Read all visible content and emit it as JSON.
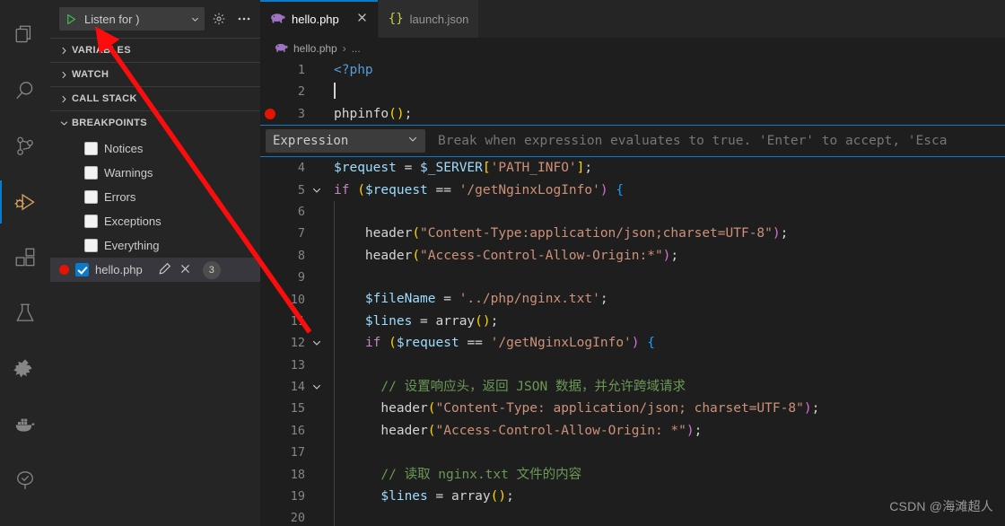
{
  "activity_bar": {
    "items": [
      {
        "name": "explorer",
        "icon": "files-icon",
        "active": false
      },
      {
        "name": "search",
        "icon": "search-icon",
        "active": false
      },
      {
        "name": "source-control",
        "icon": "source-control-icon",
        "active": false
      },
      {
        "name": "run-and-debug",
        "icon": "run-debug-icon",
        "active": true
      },
      {
        "name": "extensions",
        "icon": "extensions-icon",
        "active": false
      },
      {
        "name": "testing",
        "icon": "beaker-icon",
        "active": false
      },
      {
        "name": "php-tools",
        "icon": "php-tools-icon",
        "active": false
      },
      {
        "name": "docker",
        "icon": "docker-whale-icon",
        "active": false
      },
      {
        "name": "source-tree",
        "icon": "tree-check-icon",
        "active": false
      }
    ]
  },
  "sidebar": {
    "toolbar": {
      "start_debug_icon": "play-icon",
      "launch_config": "Listen for )",
      "dropdown_icon": "chevron-down-icon",
      "settings_icon": "gear-icon",
      "more_icon": "ellipsis-icon"
    },
    "sections": [
      {
        "label": "VARIABLES",
        "expanded": false
      },
      {
        "label": "WATCH",
        "expanded": false
      },
      {
        "label": "CALL STACK",
        "expanded": false
      },
      {
        "label": "BREAKPOINTS",
        "expanded": true
      }
    ],
    "breakpoints": [
      {
        "label": "Notices",
        "checked": false
      },
      {
        "label": "Warnings",
        "checked": false
      },
      {
        "label": "Errors",
        "checked": false
      },
      {
        "label": "Exceptions",
        "checked": false
      },
      {
        "label": "Everything",
        "checked": false
      }
    ],
    "selected_breakpoint": {
      "label": "hello.php",
      "checked": true,
      "has_red_dot": true,
      "edit_icon": "pencil-icon",
      "remove_icon": "close-icon",
      "line_badge": "3"
    }
  },
  "editor": {
    "tabs": [
      {
        "label": "hello.php",
        "icon": "php-elephant-icon",
        "active": true,
        "close_icon": "close-icon"
      },
      {
        "label": "launch.json",
        "icon": "json-braces-icon",
        "active": false
      }
    ],
    "breadcrumb": {
      "icon": "php-elephant-icon",
      "file": "hello.php",
      "separator": "›",
      "tail": "..."
    },
    "breakpoint_widget": {
      "condition_type": "Expression",
      "dropdown_icon": "chevron-down-icon",
      "placeholder": "Break when expression evaluates to true. 'Enter' to accept, 'Esca"
    },
    "lines": [
      {
        "num": "1",
        "fold": "",
        "bp": false,
        "indents": 0,
        "tokens": [
          {
            "t": "tag",
            "v": "<?php"
          }
        ]
      },
      {
        "num": "2",
        "fold": "",
        "bp": false,
        "indents": 0,
        "tokens": [
          {
            "t": "cursor",
            "v": ""
          }
        ]
      },
      {
        "num": "3",
        "fold": "",
        "bp": true,
        "indents": 0,
        "tokens": [
          {
            "t": "plain",
            "v": "phpinfo"
          },
          {
            "t": "paren",
            "v": "()"
          },
          {
            "t": "punc",
            "v": ";"
          }
        ]
      },
      {
        "num": "4",
        "fold": "",
        "bp": false,
        "indents": 0,
        "tokens": [
          {
            "t": "var",
            "v": "$request"
          },
          {
            "t": "op",
            "v": " = "
          },
          {
            "t": "var",
            "v": "$_SERVER"
          },
          {
            "t": "brk",
            "v": "["
          },
          {
            "t": "str",
            "v": "'PATH_INFO'"
          },
          {
            "t": "brk",
            "v": "]"
          },
          {
            "t": "punc",
            "v": ";"
          }
        ]
      },
      {
        "num": "5",
        "fold": "down",
        "bp": false,
        "indents": 0,
        "tokens": [
          {
            "t": "kw",
            "v": "if"
          },
          {
            "t": "plain",
            "v": " "
          },
          {
            "t": "paren",
            "v": "("
          },
          {
            "t": "var",
            "v": "$request"
          },
          {
            "t": "op",
            "v": " == "
          },
          {
            "t": "str",
            "v": "'/getNginxLogInfo'"
          },
          {
            "t": "paren",
            "v": ")"
          },
          {
            "t": "plain",
            "v": " "
          },
          {
            "t": "paren",
            "v": "{"
          }
        ]
      },
      {
        "num": "6",
        "fold": "",
        "bp": false,
        "indents": 1,
        "tokens": []
      },
      {
        "num": "7",
        "fold": "",
        "bp": false,
        "indents": 1,
        "tokens": [
          {
            "t": "plain",
            "v": "  header"
          },
          {
            "t": "paren",
            "v": "("
          },
          {
            "t": "str",
            "v": "\"Content-Type:application/json;charset=UTF-8\""
          },
          {
            "t": "paren",
            "v": ")"
          },
          {
            "t": "punc",
            "v": ";"
          }
        ]
      },
      {
        "num": "8",
        "fold": "",
        "bp": false,
        "indents": 1,
        "tokens": [
          {
            "t": "plain",
            "v": "  header"
          },
          {
            "t": "paren",
            "v": "("
          },
          {
            "t": "str",
            "v": "\"Access-Control-Allow-Origin:*\""
          },
          {
            "t": "paren",
            "v": ")"
          },
          {
            "t": "punc",
            "v": ";"
          }
        ]
      },
      {
        "num": "9",
        "fold": "",
        "bp": false,
        "indents": 1,
        "tokens": []
      },
      {
        "num": "10",
        "fold": "",
        "bp": false,
        "indents": 1,
        "tokens": [
          {
            "t": "var",
            "v": "  $fileName"
          },
          {
            "t": "op",
            "v": " = "
          },
          {
            "t": "str",
            "v": "'../php/nginx.txt'"
          },
          {
            "t": "punc",
            "v": ";"
          }
        ]
      },
      {
        "num": "11",
        "fold": "",
        "bp": false,
        "indents": 1,
        "tokens": [
          {
            "t": "var",
            "v": "  $lines"
          },
          {
            "t": "op",
            "v": " = "
          },
          {
            "t": "plain",
            "v": "array"
          },
          {
            "t": "paren",
            "v": "()"
          },
          {
            "t": "punc",
            "v": ";"
          }
        ]
      },
      {
        "num": "12",
        "fold": "down",
        "bp": false,
        "indents": 1,
        "tokens": [
          {
            "t": "plain",
            "v": "  "
          },
          {
            "t": "kw",
            "v": "if"
          },
          {
            "t": "plain",
            "v": " "
          },
          {
            "t": "paren",
            "v": "("
          },
          {
            "t": "var",
            "v": "$request"
          },
          {
            "t": "op",
            "v": " == "
          },
          {
            "t": "str",
            "v": "'/getNginxLogInfo'"
          },
          {
            "t": "paren",
            "v": ")"
          },
          {
            "t": "plain",
            "v": " "
          },
          {
            "t": "paren",
            "v": "{"
          }
        ]
      },
      {
        "num": "13",
        "fold": "",
        "bp": false,
        "indents": 1,
        "tokens": []
      },
      {
        "num": "14",
        "fold": "down",
        "bp": false,
        "indents": 1,
        "tokens": [
          {
            "t": "cmt",
            "v": "    // 设置响应头，返回 JSON 数据，并允许跨域请求"
          }
        ]
      },
      {
        "num": "15",
        "fold": "",
        "bp": false,
        "indents": 1,
        "tokens": [
          {
            "t": "plain",
            "v": "    header"
          },
          {
            "t": "paren",
            "v": "("
          },
          {
            "t": "str",
            "v": "\"Content-Type: application/json; charset=UTF-8\""
          },
          {
            "t": "paren",
            "v": ")"
          },
          {
            "t": "punc",
            "v": ";"
          }
        ]
      },
      {
        "num": "16",
        "fold": "",
        "bp": false,
        "indents": 1,
        "tokens": [
          {
            "t": "plain",
            "v": "    header"
          },
          {
            "t": "paren",
            "v": "("
          },
          {
            "t": "str",
            "v": "\"Access-Control-Allow-Origin: *\""
          },
          {
            "t": "paren",
            "v": ")"
          },
          {
            "t": "punc",
            "v": ";"
          }
        ]
      },
      {
        "num": "17",
        "fold": "",
        "bp": false,
        "indents": 1,
        "tokens": []
      },
      {
        "num": "18",
        "fold": "",
        "bp": false,
        "indents": 1,
        "tokens": [
          {
            "t": "cmt",
            "v": "    // 读取 nginx.txt 文件的内容"
          }
        ]
      },
      {
        "num": "19",
        "fold": "",
        "bp": false,
        "indents": 1,
        "tokens": [
          {
            "t": "var",
            "v": "    $lines"
          },
          {
            "t": "op",
            "v": " = "
          },
          {
            "t": "plain",
            "v": "array"
          },
          {
            "t": "paren",
            "v": "()"
          },
          {
            "t": "punc",
            "v": ";"
          }
        ]
      },
      {
        "num": "20",
        "fold": "",
        "bp": false,
        "indents": 1,
        "tokens": []
      }
    ]
  },
  "annotation": {
    "arrow_color": "#fc0d0d",
    "description": "red-arrow-pointing-to-start-debug-button"
  },
  "watermark": "CSDN @海滩超人"
}
